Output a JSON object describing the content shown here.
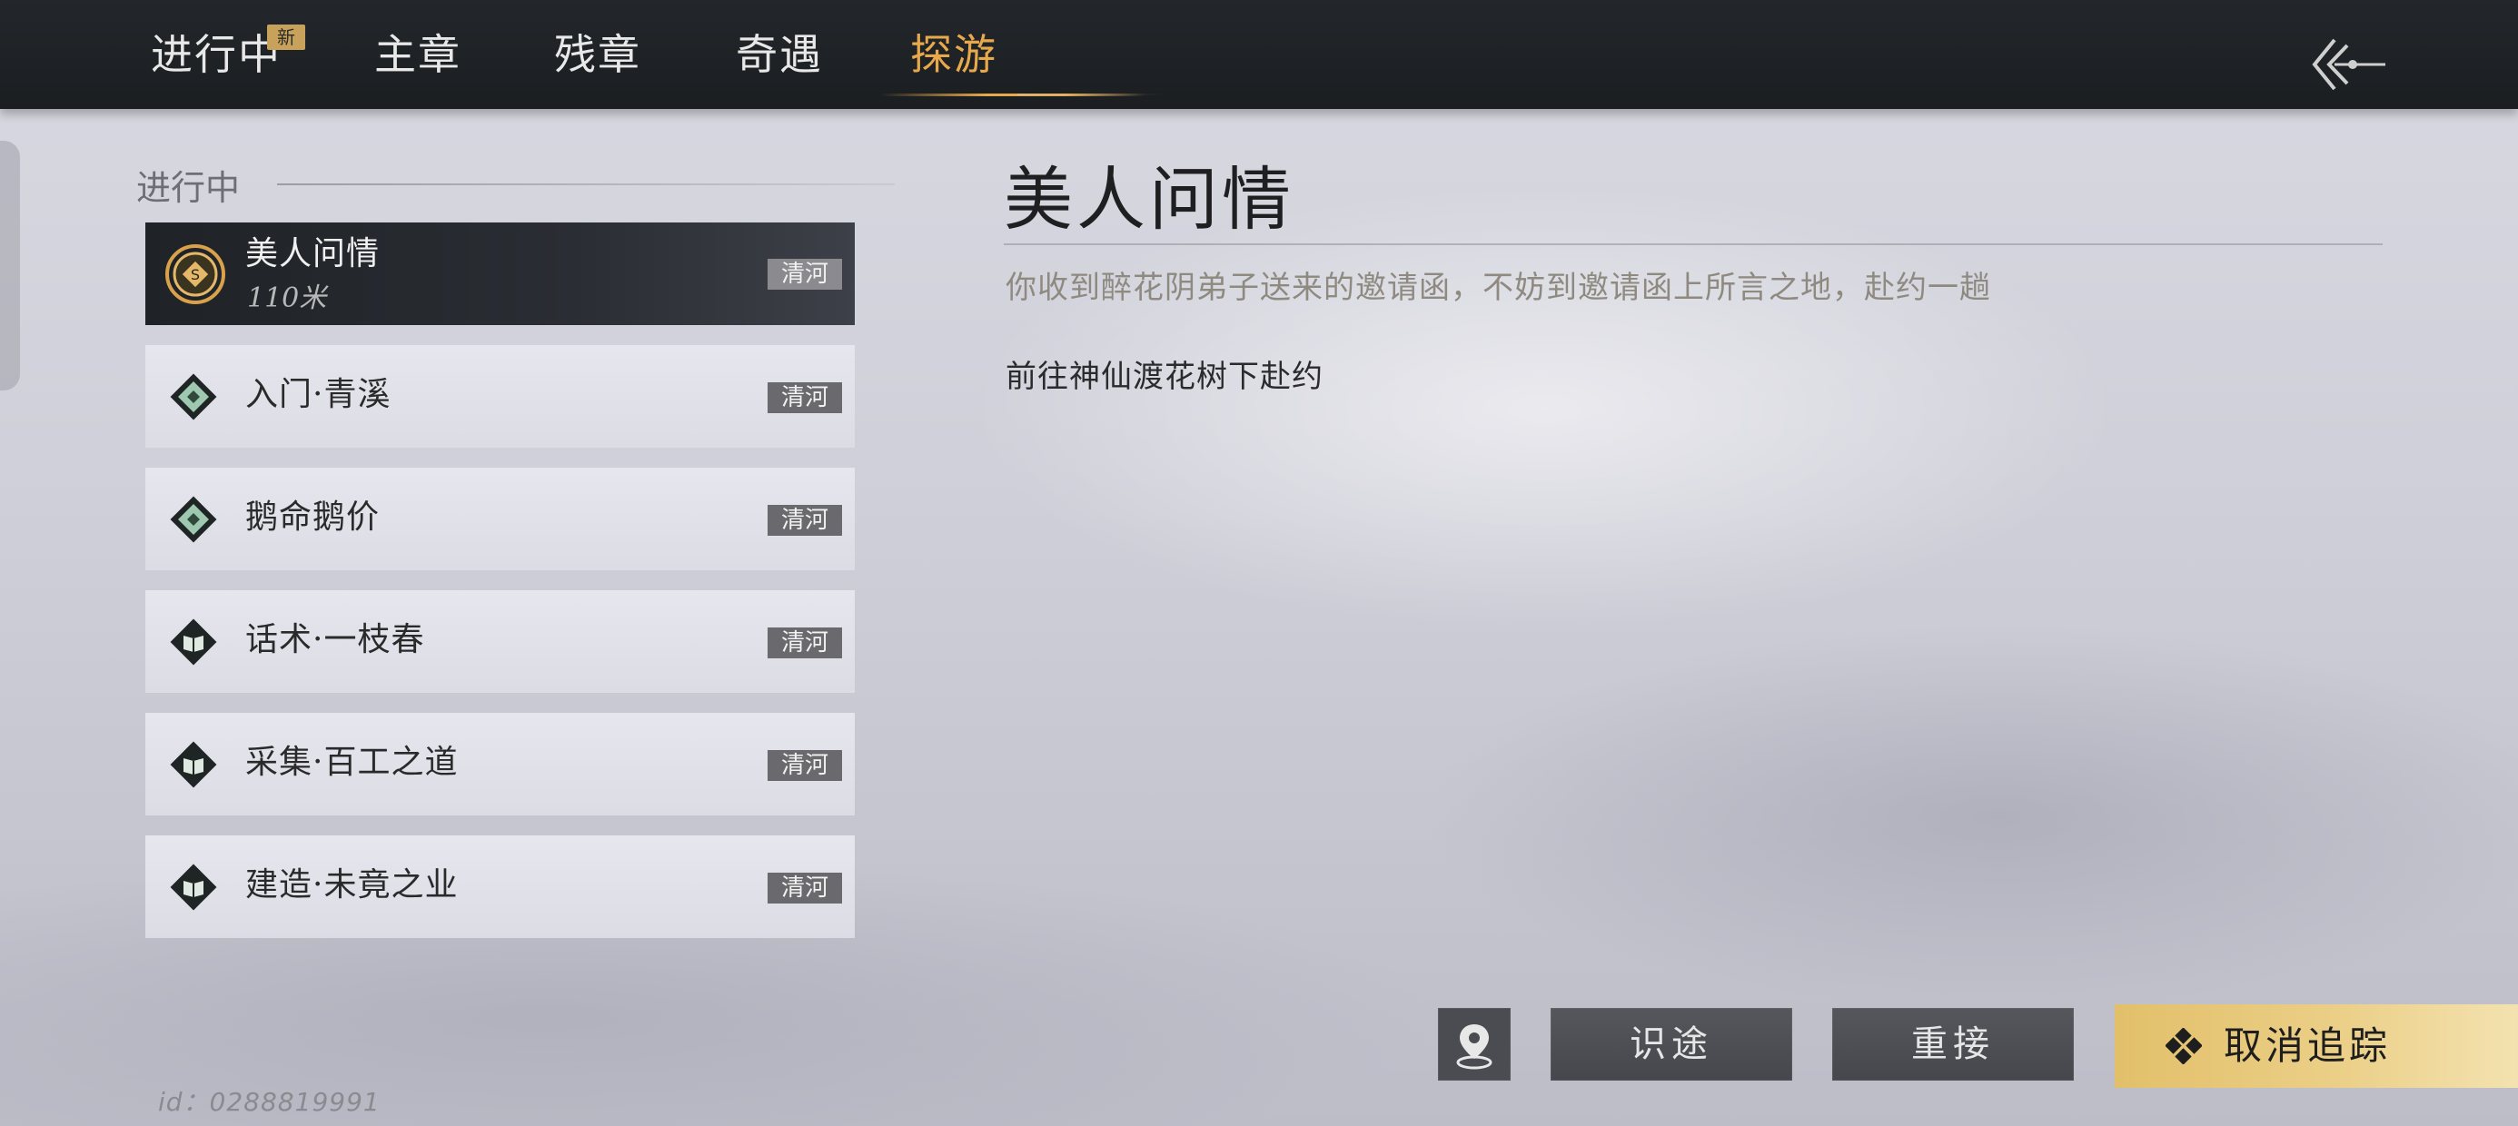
{
  "tabs": [
    {
      "label": "进行中",
      "badge": "新",
      "active": false
    },
    {
      "label": "主章",
      "active": false
    },
    {
      "label": "残章",
      "active": false
    },
    {
      "label": "奇遇",
      "active": false
    },
    {
      "label": "探游",
      "active": true
    }
  ],
  "back_icon": "back-arrow-icon",
  "list": {
    "section_label": "进行中",
    "items": [
      {
        "name": "美人问情",
        "distance": "110米",
        "region": "清河",
        "icon": "compass-gold-icon",
        "selected": true
      },
      {
        "name": "入门·青溪",
        "region": "清河",
        "icon": "jade-diamond-icon"
      },
      {
        "name": "鹅命鹅价",
        "region": "清河",
        "icon": "jade-diamond-icon"
      },
      {
        "name": "话术·一枝春",
        "region": "清河",
        "icon": "book-diamond-icon"
      },
      {
        "name": "采集·百工之道",
        "region": "清河",
        "icon": "book-diamond-icon"
      },
      {
        "name": "建造·未竟之业",
        "region": "清河",
        "icon": "book-diamond-icon"
      }
    ]
  },
  "detail": {
    "title": "美人问情",
    "description": "你收到醉花阴弟子送来的邀请函，不妨到邀请函上所言之地，赴约一趟",
    "objective": "前往神仙渡花树下赴约"
  },
  "actions": {
    "map_icon": "map-pin-icon",
    "guide_label": "识途",
    "reaccept_label": "重接",
    "untrack_label": "取消追踪",
    "untrack_icon": "diamond-icon"
  },
  "footer": {
    "user_id": "id：0288819991"
  },
  "colors": {
    "accent_gold": "#e7a94b",
    "button_gold": "#e2c06a",
    "topbar": "#1e2124"
  }
}
